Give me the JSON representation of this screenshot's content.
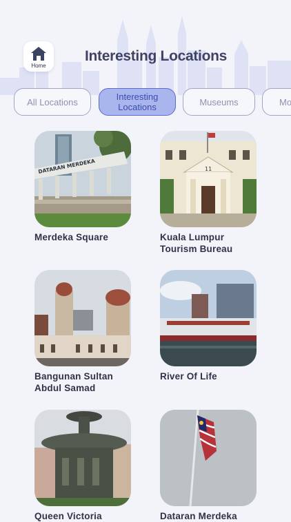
{
  "header": {
    "title": "Interesting Locations",
    "home_label": "Home"
  },
  "tabs": [
    {
      "label": "All Locations",
      "active": false
    },
    {
      "label": "Interesting Locations",
      "active": true
    },
    {
      "label": "Museums",
      "active": false
    },
    {
      "label": "Mo",
      "active": false
    }
  ],
  "locations": [
    {
      "name": "Merdeka Square",
      "photo_sign": "DATARAN MERDEKA"
    },
    {
      "name": "Kuala Lumpur Tourism Bureau",
      "photo_sign": "11"
    },
    {
      "name": "Bangunan Sultan Abdul Samad"
    },
    {
      "name": "River Of Life"
    },
    {
      "name": "Queen Victoria"
    },
    {
      "name": "Dataran Merdeka"
    }
  ],
  "colors": {
    "background": "#f3f4f9",
    "tab_active_fill": "#a9b6ee",
    "tab_active_border": "#5a68c8",
    "tab_border": "#9fa4c6",
    "title": "#3f4263"
  }
}
